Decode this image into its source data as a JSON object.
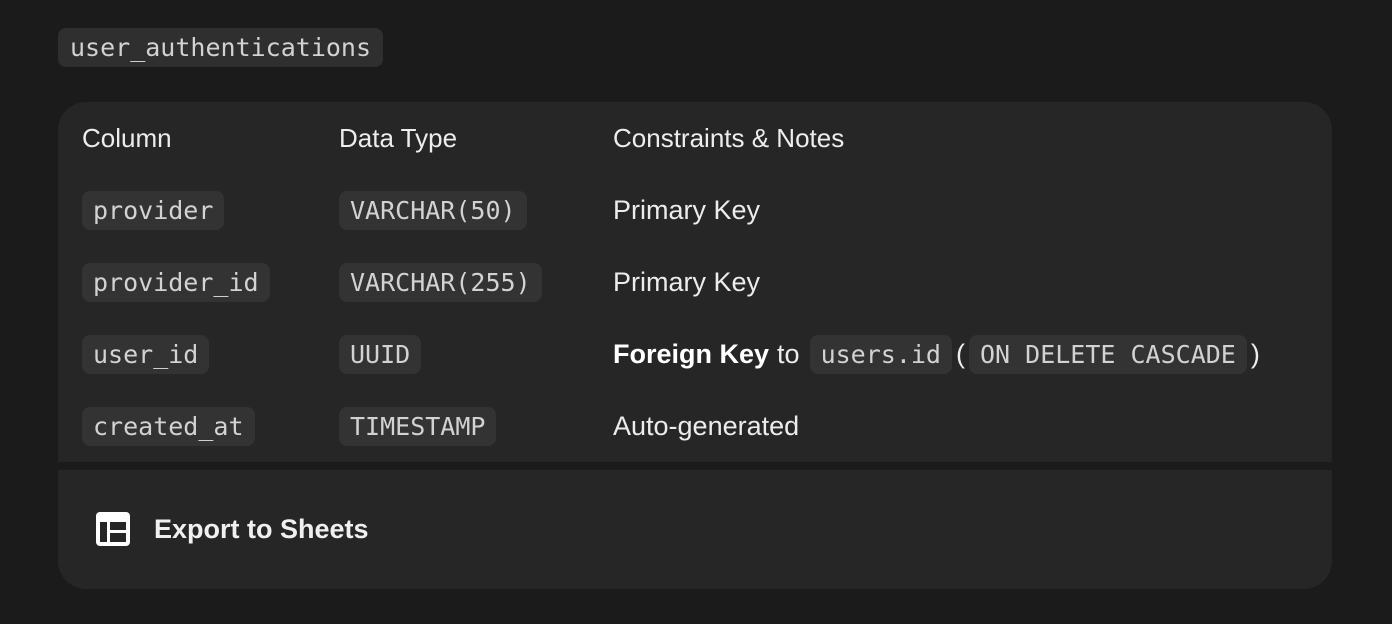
{
  "table_name": "user_authentications",
  "headers": {
    "column": "Column",
    "data_type": "Data Type",
    "constraints": "Constraints & Notes"
  },
  "rows": [
    {
      "column": "provider",
      "type": "VARCHAR(50)",
      "note": "Primary Key"
    },
    {
      "column": "provider_id",
      "type": "VARCHAR(255)",
      "note": "Primary Key"
    },
    {
      "column": "user_id",
      "type": "UUID",
      "note_parts": {
        "label": "Foreign Key",
        "to": "to",
        "ref": "users.id",
        "open_paren": "(",
        "action": "ON DELETE CASCADE",
        "close_paren": ")"
      }
    },
    {
      "column": "created_at",
      "type": "TIMESTAMP",
      "note": "Auto-generated"
    }
  ],
  "footer": {
    "export_label": "Export to Sheets",
    "export_icon": "sheets-table-icon"
  },
  "colors": {
    "background": "#1b1b1b",
    "card": "#262626",
    "chip": "#333333"
  }
}
